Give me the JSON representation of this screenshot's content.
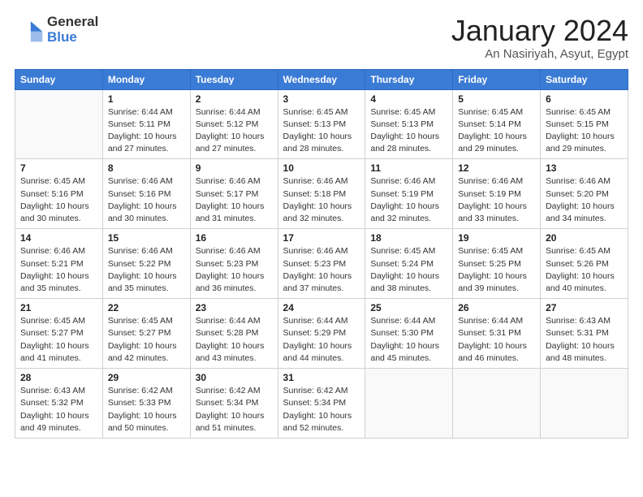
{
  "header": {
    "logo_general": "General",
    "logo_blue": "Blue",
    "title": "January 2024",
    "location": "An Nasiriyah, Asyut, Egypt"
  },
  "weekdays": [
    "Sunday",
    "Monday",
    "Tuesday",
    "Wednesday",
    "Thursday",
    "Friday",
    "Saturday"
  ],
  "weeks": [
    [
      {
        "day": "",
        "info": ""
      },
      {
        "day": "1",
        "info": "Sunrise: 6:44 AM\nSunset: 5:11 PM\nDaylight: 10 hours\nand 27 minutes."
      },
      {
        "day": "2",
        "info": "Sunrise: 6:44 AM\nSunset: 5:12 PM\nDaylight: 10 hours\nand 27 minutes."
      },
      {
        "day": "3",
        "info": "Sunrise: 6:45 AM\nSunset: 5:13 PM\nDaylight: 10 hours\nand 28 minutes."
      },
      {
        "day": "4",
        "info": "Sunrise: 6:45 AM\nSunset: 5:13 PM\nDaylight: 10 hours\nand 28 minutes."
      },
      {
        "day": "5",
        "info": "Sunrise: 6:45 AM\nSunset: 5:14 PM\nDaylight: 10 hours\nand 29 minutes."
      },
      {
        "day": "6",
        "info": "Sunrise: 6:45 AM\nSunset: 5:15 PM\nDaylight: 10 hours\nand 29 minutes."
      }
    ],
    [
      {
        "day": "7",
        "info": "Sunrise: 6:45 AM\nSunset: 5:16 PM\nDaylight: 10 hours\nand 30 minutes."
      },
      {
        "day": "8",
        "info": "Sunrise: 6:46 AM\nSunset: 5:16 PM\nDaylight: 10 hours\nand 30 minutes."
      },
      {
        "day": "9",
        "info": "Sunrise: 6:46 AM\nSunset: 5:17 PM\nDaylight: 10 hours\nand 31 minutes."
      },
      {
        "day": "10",
        "info": "Sunrise: 6:46 AM\nSunset: 5:18 PM\nDaylight: 10 hours\nand 32 minutes."
      },
      {
        "day": "11",
        "info": "Sunrise: 6:46 AM\nSunset: 5:19 PM\nDaylight: 10 hours\nand 32 minutes."
      },
      {
        "day": "12",
        "info": "Sunrise: 6:46 AM\nSunset: 5:19 PM\nDaylight: 10 hours\nand 33 minutes."
      },
      {
        "day": "13",
        "info": "Sunrise: 6:46 AM\nSunset: 5:20 PM\nDaylight: 10 hours\nand 34 minutes."
      }
    ],
    [
      {
        "day": "14",
        "info": "Sunrise: 6:46 AM\nSunset: 5:21 PM\nDaylight: 10 hours\nand 35 minutes."
      },
      {
        "day": "15",
        "info": "Sunrise: 6:46 AM\nSunset: 5:22 PM\nDaylight: 10 hours\nand 35 minutes."
      },
      {
        "day": "16",
        "info": "Sunrise: 6:46 AM\nSunset: 5:23 PM\nDaylight: 10 hours\nand 36 minutes."
      },
      {
        "day": "17",
        "info": "Sunrise: 6:46 AM\nSunset: 5:23 PM\nDaylight: 10 hours\nand 37 minutes."
      },
      {
        "day": "18",
        "info": "Sunrise: 6:45 AM\nSunset: 5:24 PM\nDaylight: 10 hours\nand 38 minutes."
      },
      {
        "day": "19",
        "info": "Sunrise: 6:45 AM\nSunset: 5:25 PM\nDaylight: 10 hours\nand 39 minutes."
      },
      {
        "day": "20",
        "info": "Sunrise: 6:45 AM\nSunset: 5:26 PM\nDaylight: 10 hours\nand 40 minutes."
      }
    ],
    [
      {
        "day": "21",
        "info": "Sunrise: 6:45 AM\nSunset: 5:27 PM\nDaylight: 10 hours\nand 41 minutes."
      },
      {
        "day": "22",
        "info": "Sunrise: 6:45 AM\nSunset: 5:27 PM\nDaylight: 10 hours\nand 42 minutes."
      },
      {
        "day": "23",
        "info": "Sunrise: 6:44 AM\nSunset: 5:28 PM\nDaylight: 10 hours\nand 43 minutes."
      },
      {
        "day": "24",
        "info": "Sunrise: 6:44 AM\nSunset: 5:29 PM\nDaylight: 10 hours\nand 44 minutes."
      },
      {
        "day": "25",
        "info": "Sunrise: 6:44 AM\nSunset: 5:30 PM\nDaylight: 10 hours\nand 45 minutes."
      },
      {
        "day": "26",
        "info": "Sunrise: 6:44 AM\nSunset: 5:31 PM\nDaylight: 10 hours\nand 46 minutes."
      },
      {
        "day": "27",
        "info": "Sunrise: 6:43 AM\nSunset: 5:31 PM\nDaylight: 10 hours\nand 48 minutes."
      }
    ],
    [
      {
        "day": "28",
        "info": "Sunrise: 6:43 AM\nSunset: 5:32 PM\nDaylight: 10 hours\nand 49 minutes."
      },
      {
        "day": "29",
        "info": "Sunrise: 6:42 AM\nSunset: 5:33 PM\nDaylight: 10 hours\nand 50 minutes."
      },
      {
        "day": "30",
        "info": "Sunrise: 6:42 AM\nSunset: 5:34 PM\nDaylight: 10 hours\nand 51 minutes."
      },
      {
        "day": "31",
        "info": "Sunrise: 6:42 AM\nSunset: 5:34 PM\nDaylight: 10 hours\nand 52 minutes."
      },
      {
        "day": "",
        "info": ""
      },
      {
        "day": "",
        "info": ""
      },
      {
        "day": "",
        "info": ""
      }
    ]
  ]
}
